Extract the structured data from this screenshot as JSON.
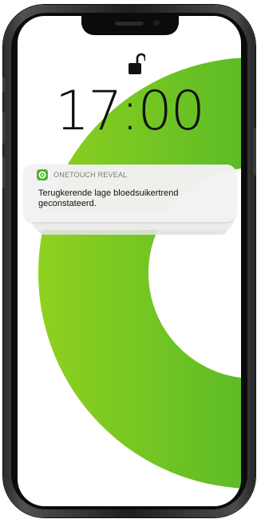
{
  "lock_screen": {
    "time": "17:00",
    "lock_state_icon": "unlocked-padlock-icon"
  },
  "notification": {
    "app_icon": "onetouch-reveal-app-icon",
    "app_name": "ONETOUCH REVEAL",
    "message": "Terugkerende lage bloedsuikertrend geconstateerd."
  },
  "colors": {
    "wallpaper_green_light": "#8fd11f",
    "wallpaper_green_dark": "#33a52b",
    "app_icon_green": "#47b72d",
    "phone_frame": "#1e1e1e"
  }
}
